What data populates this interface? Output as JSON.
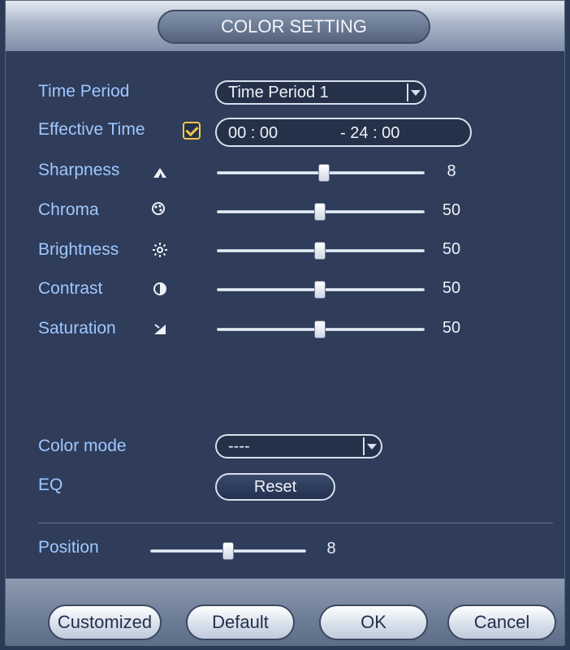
{
  "window": {
    "title": "COLOR SETTING"
  },
  "time_period": {
    "label": "Time Period",
    "selected": "Time Period 1"
  },
  "effective_time": {
    "label": "Effective Time",
    "checked": true,
    "start": "00 : 00",
    "separator": "- 24 : 00"
  },
  "sliders": {
    "sharpness": {
      "label": "Sharpness",
      "value": "8",
      "level": 0.5
    },
    "chroma": {
      "label": "Chroma",
      "value": "50",
      "level": 0.5
    },
    "brightness": {
      "label": "Brightness",
      "value": "50",
      "level": 0.5
    },
    "contrast": {
      "label": "Contrast",
      "value": "50",
      "level": 0.5
    },
    "saturation": {
      "label": "Saturation",
      "value": "50",
      "level": 0.5
    }
  },
  "color_mode": {
    "label": "Color mode",
    "selected": "----"
  },
  "eq": {
    "label": "EQ",
    "button": "Reset"
  },
  "position": {
    "label": "Position",
    "value": "8",
    "level": 0.5
  },
  "footer": {
    "customized": "Customized",
    "default": "Default",
    "ok": "OK",
    "cancel": "Cancel"
  },
  "colors": {
    "label_blue": "#9fc8ff",
    "panel_bg": "#2f3c5a",
    "checkbox": "#f0c84a"
  }
}
